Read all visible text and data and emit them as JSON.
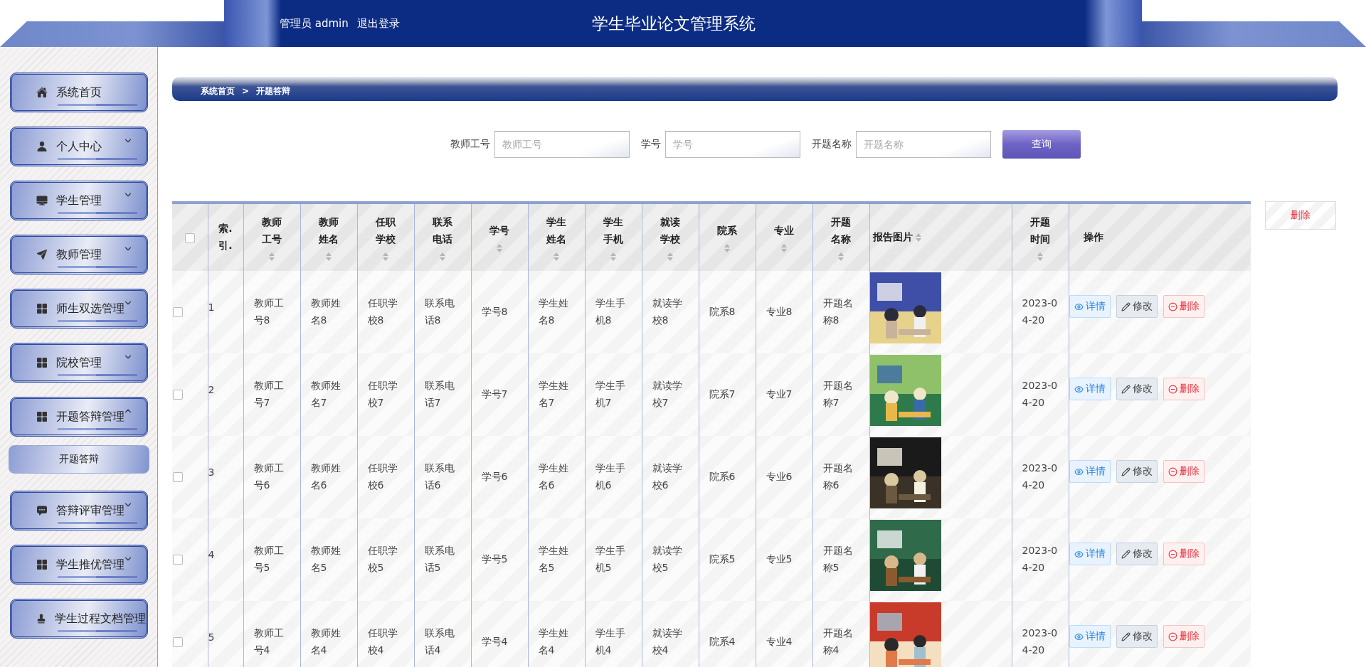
{
  "header": {
    "user_label": "管理员 admin",
    "logout": "退出登录",
    "title": "学生毕业论文管理系统"
  },
  "sidebar": {
    "items": [
      {
        "label": "系统首页"
      },
      {
        "label": "个人中心",
        "expanded": false
      },
      {
        "label": "学生管理",
        "expanded": false
      },
      {
        "label": "教师管理",
        "expanded": false
      },
      {
        "label": "师生双选管理",
        "expanded": false
      },
      {
        "label": "院校管理",
        "expanded": false
      },
      {
        "label": "开题答辩管理",
        "expanded": true,
        "children": [
          {
            "label": "开题答辩",
            "selected": true
          }
        ]
      },
      {
        "label": "答辩评审管理",
        "expanded": false
      },
      {
        "label": "学生推优管理",
        "expanded": false
      },
      {
        "label": "学生过程文档管理"
      }
    ]
  },
  "breadcrumb": [
    "系统首页",
    ">",
    "开题答辩"
  ],
  "search": {
    "fields": [
      {
        "label": "教师工号",
        "placeholder": "教师工号"
      },
      {
        "label": "学号",
        "placeholder": "学号"
      },
      {
        "label": "开题名称",
        "placeholder": "开题名称"
      }
    ],
    "button": "查询"
  },
  "batch_delete": "删除",
  "table": {
    "select_all": {
      "checked": false
    },
    "columns": [
      {
        "label": "索.引.",
        "sortable": false
      },
      {
        "label": "教师工号",
        "sortable": true
      },
      {
        "label": "教师姓名",
        "sortable": true
      },
      {
        "label": "任职学校",
        "sortable": true
      },
      {
        "label": "联系电话",
        "sortable": true
      },
      {
        "label": "学号",
        "sortable": true
      },
      {
        "label": "学生姓名",
        "sortable": true
      },
      {
        "label": "学生手机",
        "sortable": true
      },
      {
        "label": "就读学校",
        "sortable": true
      },
      {
        "label": "院系",
        "sortable": true
      },
      {
        "label": "专业",
        "sortable": true
      },
      {
        "label": "开题名称",
        "sortable": true
      },
      {
        "label": "报告图片",
        "sortable": true
      },
      {
        "label": "开题时间",
        "sortable": true
      },
      {
        "label": "操作",
        "sortable": false,
        "kind": "actions"
      }
    ],
    "rows": [
      {
        "checked": false,
        "cells": [
          "1",
          "教师工号8",
          "教师姓名8",
          "任职学校8",
          "联系电话8",
          "学号8",
          "学生姓名8",
          "学生手机8",
          "就读学校8",
          "院系8",
          "专业8",
          "开题名称8",
          {
            "kind": "picture"
          },
          "2023-04-20"
        ],
        "actions": [
          "详情",
          "修改",
          "删除"
        ]
      },
      {
        "checked": false,
        "cells": [
          "2",
          "教师工号7",
          "教师姓名7",
          "任职学校7",
          "联系电话7",
          "学号7",
          "学生姓名7",
          "学生手机7",
          "就读学校7",
          "院系7",
          "专业7",
          "开题名称7",
          {
            "kind": "picture"
          },
          "2023-04-20"
        ],
        "actions": [
          "详情",
          "修改",
          "删除"
        ]
      },
      {
        "checked": false,
        "cells": [
          "3",
          "教师工号6",
          "教师姓名6",
          "任职学校6",
          "联系电话6",
          "学号6",
          "学生姓名6",
          "学生手机6",
          "就读学校6",
          "院系6",
          "专业6",
          "开题名称6",
          {
            "kind": "picture"
          },
          "2023-04-20"
        ],
        "actions": [
          "详情",
          "修改",
          "删除"
        ]
      },
      {
        "checked": false,
        "cells": [
          "4",
          "教师工号5",
          "教师姓名5",
          "任职学校5",
          "联系电话5",
          "学号5",
          "学生姓名5",
          "学生手机5",
          "就读学校5",
          "院系5",
          "专业5",
          "开题名称5",
          {
            "kind": "picture"
          },
          "2023-04-20"
        ],
        "actions": [
          "详情",
          "修改",
          "删除"
        ]
      },
      {
        "checked": false,
        "cells": [
          "5",
          "教师工号4",
          "教师姓名4",
          "任职学校4",
          "联系电话4",
          "学号4",
          "学生姓名4",
          "学生手机4",
          "就读学校4",
          "院系4",
          "专业4",
          "开题名称4",
          {
            "kind": "picture"
          },
          "2023-04-20"
        ],
        "actions": [
          "详情",
          "修改",
          "删除"
        ]
      }
    ]
  }
}
